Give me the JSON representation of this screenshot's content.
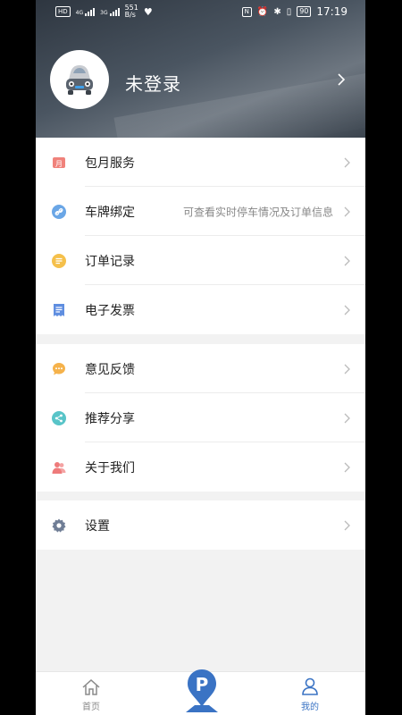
{
  "status_bar": {
    "hd_label": "HD",
    "net1": "4G",
    "net2": "3G",
    "speed_value": "551",
    "speed_unit": "B/s",
    "battery": "90",
    "time": "17:19"
  },
  "profile": {
    "login_status": "未登录"
  },
  "menu_group_1": [
    {
      "label": "包月服务",
      "icon": "calendar-month-icon",
      "color": "#f0827b"
    },
    {
      "label": "车牌绑定",
      "icon": "link-icon",
      "color": "#6aa6e6",
      "hint": "可查看实时停车情况及订单信息"
    },
    {
      "label": "订单记录",
      "icon": "order-list-icon",
      "color": "#f5c04b"
    },
    {
      "label": "电子发票",
      "icon": "receipt-icon",
      "color": "#5f8ee0"
    }
  ],
  "menu_group_2": [
    {
      "label": "意见反馈",
      "icon": "chat-bubble-icon",
      "color": "#f5b24b"
    },
    {
      "label": "推荐分享",
      "icon": "share-icon",
      "color": "#58c4c8"
    },
    {
      "label": "关于我们",
      "icon": "people-icon",
      "color": "#ee7b7b"
    }
  ],
  "menu_group_3": [
    {
      "label": "设置",
      "icon": "gear-icon",
      "color": "#6f7d95"
    }
  ],
  "bottom_nav": {
    "home": "首页",
    "center_icon": "parking-icon",
    "mine": "我的",
    "active_color": "#3a73c4",
    "inactive_color": "#8a8a8a"
  }
}
